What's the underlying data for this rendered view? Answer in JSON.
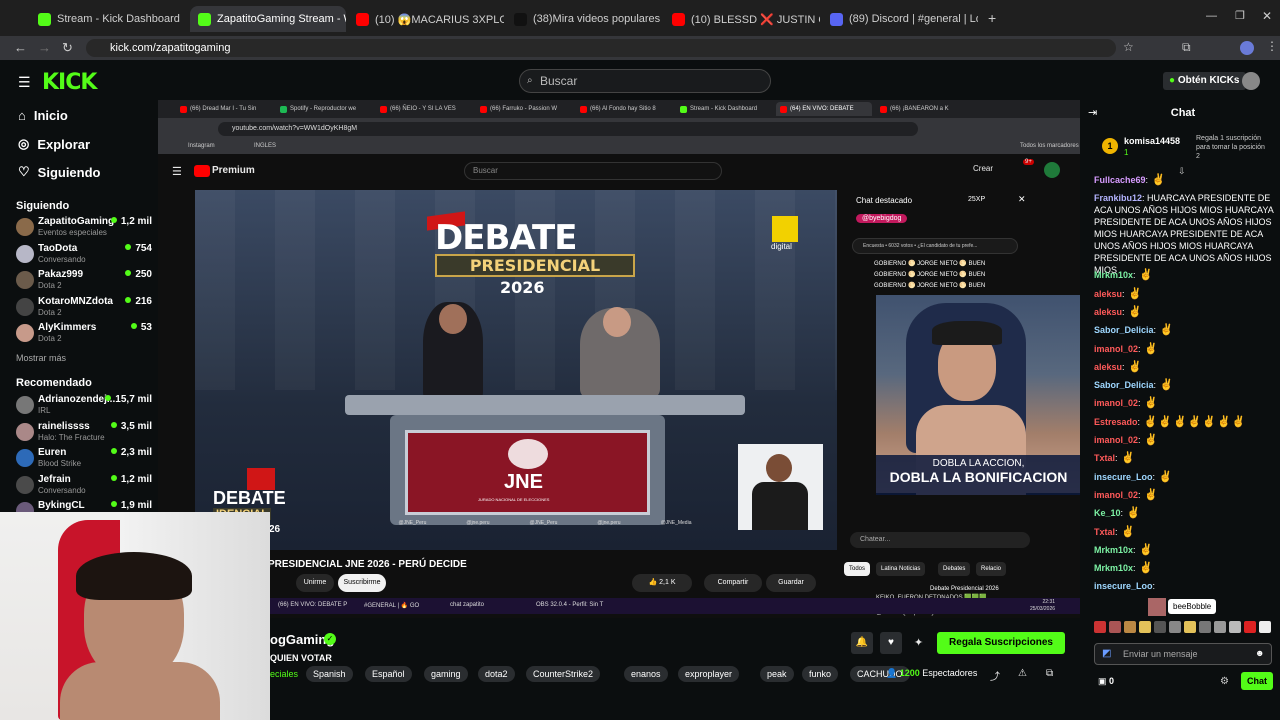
{
  "browser_tabs": [
    {
      "label": "Stream - Kick Dashboard",
      "color": "#53fc18"
    },
    {
      "label": "ZapatitoGaming Stream - W",
      "color": "#53fc18"
    },
    {
      "label": "(10) 😱MACARIUS 3XPLOT0 y M",
      "color": "#ff0000"
    },
    {
      "label": "(38)Mira videos populares sele",
      "color": "#111111"
    },
    {
      "label": "(10) BLESSD ❌ JUSTIN QUILES",
      "color": "#ff0000"
    },
    {
      "label": "(89) Discord | #general | Lo",
      "color": "#5865f2"
    }
  ],
  "url": "kick.com/zapatitogaming",
  "kick": {
    "logo": "KICK",
    "search_placeholder": "Buscar",
    "get_kicks": "Obtén KICKs"
  },
  "nav": [
    {
      "label": "Inicio",
      "icon": "home-icon"
    },
    {
      "label": "Explorar",
      "icon": "compass-icon"
    },
    {
      "label": "Siguiendo",
      "icon": "heart-icon"
    }
  ],
  "following_title": "Siguiendo",
  "following": [
    {
      "name": "ZapatitoGaming",
      "sub": "Eventos especiales",
      "viewers": "1,2 mil",
      "color": "#8a6a4a"
    },
    {
      "name": "TaoDota",
      "sub": "Conversando",
      "viewers": "754",
      "color": "#b7b7c7"
    },
    {
      "name": "Pakaz999",
      "sub": "Dota 2",
      "viewers": "250",
      "color": "#6b5b4b"
    },
    {
      "name": "KotaroMNZdota",
      "sub": "Dota 2",
      "viewers": "216",
      "color": "#444444"
    },
    {
      "name": "AlyKimmers",
      "sub": "Dota 2",
      "viewers": "53",
      "color": "#c79a8a"
    }
  ],
  "show_more": "Mostrar más",
  "recommended_title": "Recomendado",
  "recommended": [
    {
      "name": "Adrianozendej...",
      "sub": "IRL",
      "viewers": "15,7 mil",
      "color": "#777777"
    },
    {
      "name": "rainelissss",
      "sub": "Halo: The Fracture",
      "viewers": "3,5 mil",
      "color": "#a88"
    },
    {
      "name": "Euren",
      "sub": "Blood Strike",
      "viewers": "2,3 mil",
      "color": "#2d6ab8"
    },
    {
      "name": "Jefrain",
      "sub": "Conversando",
      "viewers": "1,2 mil",
      "color": "#4a4a4a"
    },
    {
      "name": "BykingCL",
      "sub": "",
      "viewers": "1,9 mil",
      "color": "#6a5a7a"
    }
  ],
  "inner_browser": {
    "tabs": [
      "(66) Dread Mar I - Tu Sin",
      "Spotify - Reproductor we",
      "(66) ÑEIO - Y SI LA VES",
      "(66) Farruko - Passion W",
      "(66) Al Fondo hay Sitio 8",
      "Stream - Kick Dashboard",
      "(64) EN VIVO: DEBATE",
      "(66) ¡BANEARON a K"
    ],
    "url": "youtube.com/watch?v=WW1dOyKH8gM",
    "bookmarks": [
      "Instagram",
      "INGLES"
    ],
    "all_bookmarks": "Todos los marcadores",
    "yt_logo": "Premium",
    "yt_search": "Buscar",
    "create": "Crear",
    "notif_count": "9+"
  },
  "video": {
    "debate": "DEBATE",
    "presidential": "PRESIDENCIAL",
    "year": "2026",
    "jne": "JNE",
    "jne_sub": "JURADO NACIONAL DE ELECCIONES",
    "digital": "digital",
    "corner_debate": "DEBATE",
    "corner_sub": "IDENCIAL",
    "corner_year": "26",
    "handles": [
      "@JNE_Peru",
      "@jne.peru",
      "@JNE_Peru",
      "@jne.peru",
      "@JNE_Media"
    ]
  },
  "yt_chat": {
    "title": "Chat destacado",
    "pts": "25XP",
    "pinned": "@byebigdog",
    "poll": "Encuesta • 6032 votos • ¿El candidato de tu prefe...",
    "rows": [
      "GOBIERNO 🌕 JORGE NIETO 🌕 BUEN",
      "GOBIERNO 🌕 JORGE NIETO 🌕 BUEN",
      "GOBIERNO 🌕 JORGE NIETO 🌕 BUEN"
    ],
    "bottom1": "KEIKO, FUERON DETONADOS 🟩🟩🟩",
    "bottom2": "@GabrielQuispelozaya-w7n  vamos keiko",
    "input": "Chatear..."
  },
  "overlay": {
    "line1": "DOBLA LA ACCION,",
    "line2": "DOBLA LA BONIFICACION"
  },
  "video_title": "PRESIDENCIAL JNE 2026 - PERÚ DECIDE",
  "yt_actions": {
    "join": "Unirme",
    "subscribe": "Suscribirme",
    "likes": "2,1 K",
    "share": "Compartir",
    "save": "Guardar"
  },
  "yt_filters": [
    "Todos",
    "Latina Noticias",
    "Debates",
    "Relacio"
  ],
  "related": "Debate Presidencial 2026",
  "taskbar": {
    "items": [
      "(66) EN VIVO: DEBATE P",
      "#GENERAL | 🔥 GO",
      "chat zapatito",
      "OBS 32.0.4 - Perfil: Sin T"
    ],
    "lang": "ESP\nLAA",
    "time": "22:31",
    "date": "25/03/2026"
  },
  "channel": {
    "name": "ogGaming",
    "subtitle": "QUIEN VOTAR",
    "category": "eciales",
    "tags": [
      "Spanish",
      "Español",
      "gaming",
      "dota2",
      "CounterStrike2",
      "enanos",
      "exproplayer",
      "peak",
      "funko",
      "CACHUDO"
    ],
    "viewers": "1200",
    "viewers_label": "Espectadores",
    "gift_button": "Regala Suscripciones"
  },
  "chat": {
    "title": "Chat",
    "top_gifter": "komisa14458",
    "top_count": "1",
    "gift_prompt": "Regala 1 suscripción para tomar la posición 2",
    "messages": [
      {
        "user": "Fullcache69",
        "text": "",
        "color": "#d79cff",
        "emotes": 1
      },
      {
        "user": "Frankibu12",
        "text": "HUARCAYA PRESIDENTE DE ACA UNOS AÑOS HIJOS MIOS HUARCAYA PRESIDENTE DE ACA UNOS AÑOS HIJOS MIOS HUARCAYA PRESIDENTE DE ACA UNOS AÑOS HIJOS MIOS HUARCAYA PRESIDENTE DE ACA UNOS AÑOS HIJOS MIOS",
        "color": "#b4b4ff",
        "emotes": 0
      },
      {
        "user": "Mrkm10x",
        "text": "",
        "color": "#7df3a5",
        "emotes": 1
      },
      {
        "user": "aleksu",
        "text": "",
        "color": "#ff5a5a",
        "emotes": 1
      },
      {
        "user": "aleksu",
        "text": "",
        "color": "#ff5a5a",
        "emotes": 1
      },
      {
        "user": "Sabor_Delicia",
        "text": "",
        "color": "#9ed7ff",
        "emotes": 1
      },
      {
        "user": "imanol_02",
        "text": "",
        "color": "#ff5a5a",
        "emotes": 1
      },
      {
        "user": "aleksu",
        "text": "",
        "color": "#ff5a5a",
        "emotes": 1
      },
      {
        "user": "Sabor_Delicia",
        "text": "",
        "color": "#9ed7ff",
        "emotes": 1
      },
      {
        "user": "imanol_02",
        "text": "",
        "color": "#ff5a5a",
        "emotes": 1
      },
      {
        "user": "Estresado",
        "text": "",
        "color": "#ff5a5a",
        "emotes": 7
      },
      {
        "user": "imanol_02",
        "text": "",
        "color": "#ff5a5a",
        "emotes": 1
      },
      {
        "user": "Txtal",
        "text": "",
        "color": "#ff5a5a",
        "emotes": 1
      },
      {
        "user": "insecure_Loo",
        "text": "",
        "color": "#9ed7ff",
        "emotes": 1
      },
      {
        "user": "imanol_02",
        "text": "",
        "color": "#ff5a5a",
        "emotes": 1
      },
      {
        "user": "Ke_10",
        "text": "",
        "color": "#7df3a5",
        "emotes": 1
      },
      {
        "user": "Txtal",
        "text": "",
        "color": "#ff5a5a",
        "emotes": 1
      },
      {
        "user": "Mrkm10x",
        "text": "",
        "color": "#7df3a5",
        "emotes": 1
      },
      {
        "user": "Mrkm10x",
        "text": "",
        "color": "#7df3a5",
        "emotes": 1
      },
      {
        "user": "insecure_Loo",
        "text": "",
        "color": "#9ed7ff",
        "emotes": 0
      }
    ],
    "tooltip": "beeBobble",
    "input_placeholder": "Enviar un mensaje",
    "kicks": "0",
    "send": "Chat"
  },
  "colors": {
    "kick_green": "#53fc18",
    "bg": "#0b0e0f"
  }
}
